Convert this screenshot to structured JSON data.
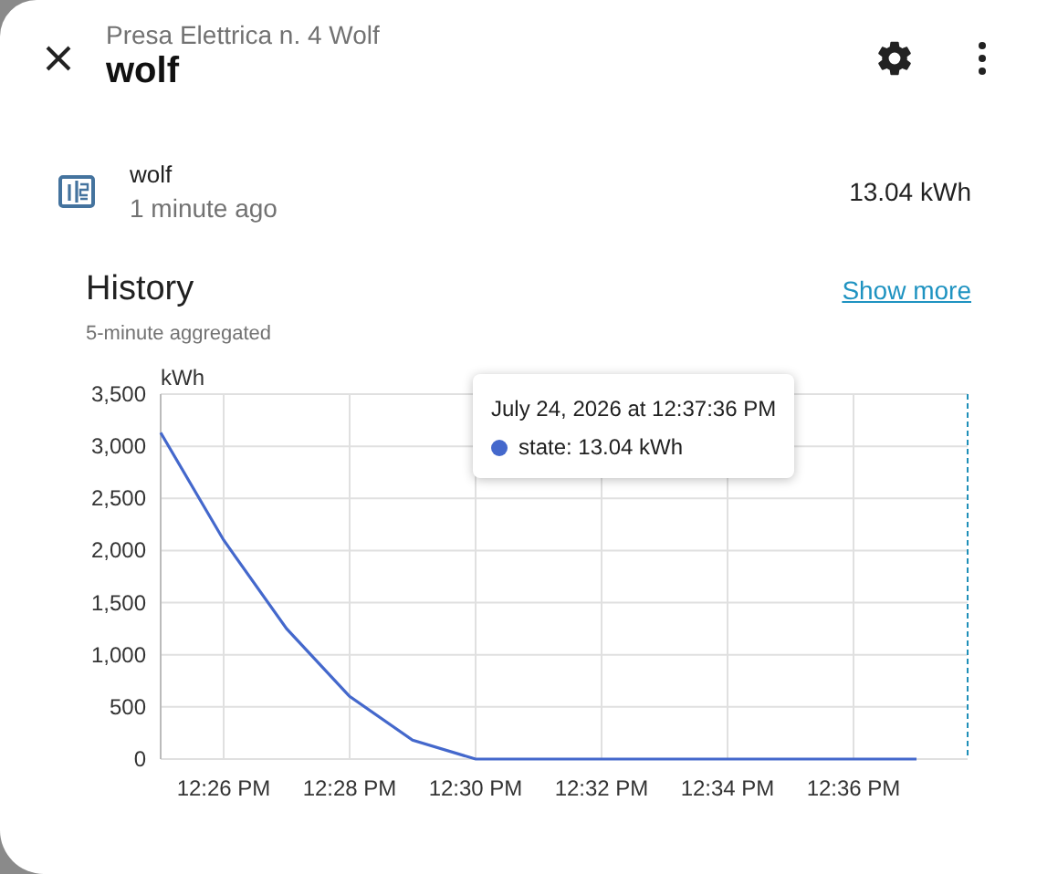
{
  "header": {
    "subtitle": "Presa Elettrica n. 4 Wolf",
    "title": "wolf"
  },
  "entity": {
    "name": "wolf",
    "updated": "1 minute ago",
    "state": "13.04 kWh"
  },
  "history": {
    "title": "History",
    "subtitle": "5-minute aggregated",
    "link": "Show more",
    "chart_data": {
      "type": "line",
      "ylabel": "kWh",
      "categories": [
        null,
        "12:26 PM",
        null,
        "12:28 PM",
        null,
        "12:30 PM",
        null,
        "12:32 PM",
        null,
        "12:34 PM",
        null,
        "12:36 PM",
        null
      ],
      "series": [
        {
          "name": "state",
          "color": "#4468cc",
          "values": [
            3130,
            2100,
            1250,
            600,
            180,
            0,
            0,
            0,
            0,
            0,
            0,
            0,
            0
          ]
        }
      ],
      "ylim": [
        0,
        3500
      ],
      "grid": true,
      "yticks": [
        {
          "value": 0,
          "label": "0"
        },
        {
          "value": 500,
          "label": "500"
        },
        {
          "value": 1000,
          "label": "1,000"
        },
        {
          "value": 1500,
          "label": "1,500"
        },
        {
          "value": 2000,
          "label": "2,000"
        },
        {
          "value": 2500,
          "label": "2,500"
        },
        {
          "value": 3000,
          "label": "3,000"
        },
        {
          "value": 3500,
          "label": "3,500"
        }
      ]
    },
    "tooltip": {
      "time": "July 24, 2026 at 12:37:36 PM",
      "value": ": 13.04 kWh"
    }
  }
}
